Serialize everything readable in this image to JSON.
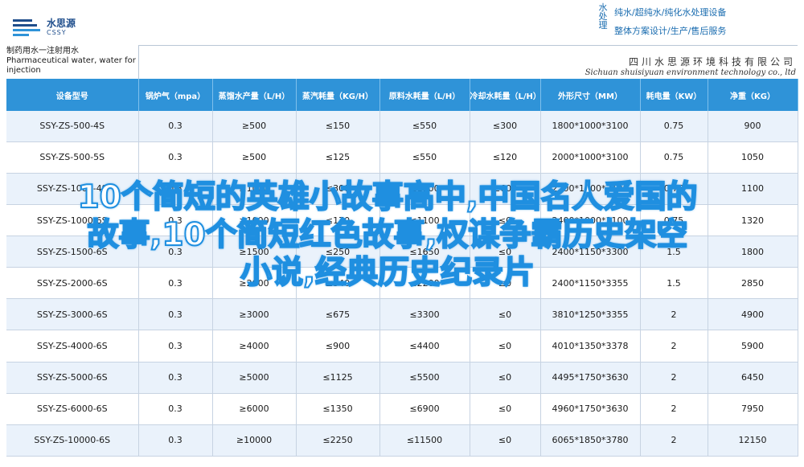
{
  "header": {
    "logo_cn": "水思源",
    "logo_en": "CSSY",
    "brand_col": "水处理",
    "brand_line1": "纯水/超纯水/纯化水处理设备",
    "brand_line2": "整体方案设计/生产/售后服务"
  },
  "title": {
    "cn": "制药用水一注射用水",
    "en": "Pharmaceutical water, water for injection"
  },
  "company": {
    "cn": "四川水思源环境科技有限公司",
    "en": "Sichuan shuisiyuan environment technology co., ltd"
  },
  "table": {
    "headers": [
      "设备型号",
      "锅炉气（mpa）",
      "蒸馏水产量（L/H）",
      "蒸汽耗量（KG/H）",
      "原料水耗量（L/H）",
      "冷却水耗量（L/H）",
      "外形尺寸（MM）",
      "耗电量（KW）",
      "净重（KG）"
    ],
    "rows": [
      [
        "SSY-ZS-500-4S",
        "0.3",
        "≥500",
        "≤150",
        "≤550",
        "≤300",
        "1800*1000*3100",
        "0.75",
        "900"
      ],
      [
        "SSY-ZS-500-5S",
        "0.3",
        "≥500",
        "≤125",
        "≤550",
        "≤120",
        "2000*1000*3100",
        "0.75",
        "1050"
      ],
      [
        "SSY-ZS-1000-4S",
        "0.3",
        "≥1000",
        "≤300",
        "≤1100",
        "≤600",
        "2200*1000*3100",
        "0.75",
        "1100"
      ],
      [
        "SSY-ZS-1000-6S",
        "0.3",
        "≥1000",
        "≤170",
        "≤1100",
        "≤0",
        "2400*1000*3100",
        "0.75",
        "1320"
      ],
      [
        "SSY-ZS-1500-6S",
        "0.3",
        "≥1500",
        "≤250",
        "≤1650",
        "≤0",
        "2400*1150*3300",
        "1.5",
        "1800"
      ],
      [
        "SSY-ZS-2000-6S",
        "0.3",
        "≥2000",
        "≤340",
        "≤2200",
        "≤0",
        "2400*1150*3355",
        "1.5",
        "2850"
      ],
      [
        "SSY-ZS-3000-6S",
        "0.3",
        "≥3000",
        "≤675",
        "≤3300",
        "≤0",
        "3810*1250*3355",
        "2",
        "4900"
      ],
      [
        "SSY-ZS-4000-6S",
        "0.3",
        "≥4000",
        "≤900",
        "≤4400",
        "≤0",
        "4010*1350*3378",
        "2",
        "5900"
      ],
      [
        "SSY-ZS-5000-6S",
        "0.3",
        "≥5000",
        "≤1125",
        "≤5500",
        "≤0",
        "4495*1750*3630",
        "2",
        "6450"
      ],
      [
        "SSY-ZS-6000-6S",
        "0.3",
        "≥6000",
        "≤1350",
        "≤6900",
        "≤0",
        "4960*1750*3630",
        "2",
        "7950"
      ],
      [
        "SSY-ZS-10000-6S",
        "0.3",
        "≥10000",
        "≤2250",
        "≤11500",
        "≤0",
        "6065*1850*3780",
        "2",
        "12150"
      ]
    ]
  },
  "overlay": {
    "line1": "10个简短的英雄小故事高中,中国名人爱国的",
    "line2": "故事,10个简短红色故事,权谋争霸历史架空",
    "line3": "小说,经典历史纪录片"
  }
}
